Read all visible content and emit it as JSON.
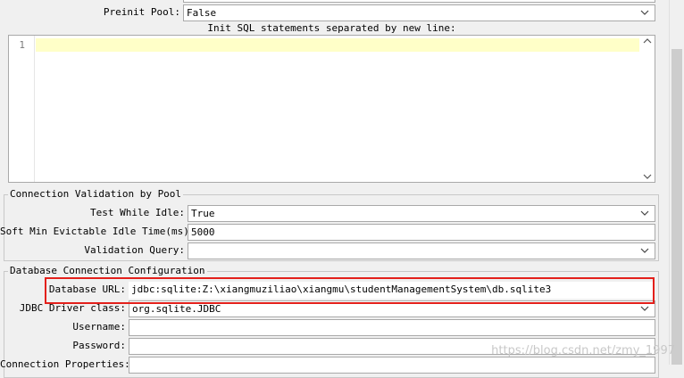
{
  "pool": {
    "preinit_label": "Preinit Pool:",
    "preinit_value": "False",
    "init_sql_label": "Init SQL statements separated by new line:",
    "editor_line_number": "1"
  },
  "validation": {
    "title": "Connection Validation by Pool",
    "test_while_idle_label": "Test While Idle:",
    "test_while_idle_value": "True",
    "soft_min_label": "Soft Min Evictable Idle Time(ms):",
    "soft_min_value": "5000",
    "validation_query_label": "Validation Query:",
    "validation_query_value": ""
  },
  "database": {
    "title": "Database Connection Configuration",
    "url_label": "Database URL:",
    "url_value": "jdbc:sqlite:Z:\\xiangmuziliao\\xiangmu\\studentManagementSystem\\db.sqlite3",
    "driver_label": "JDBC Driver class:",
    "driver_value": "org.sqlite.JDBC",
    "username_label": "Username:",
    "username_value": "",
    "password_label": "Password:",
    "password_value": "",
    "props_label": "Connection Properties:"
  },
  "watermark": "https://blog.csdn.net/zmy_1997",
  "colors": {
    "highlight_border": "#e3201b",
    "active_line": "#ffffc8"
  },
  "icons": {
    "dropdown": "chevron-down-icon",
    "scroll": "scrollbar-thumb"
  }
}
